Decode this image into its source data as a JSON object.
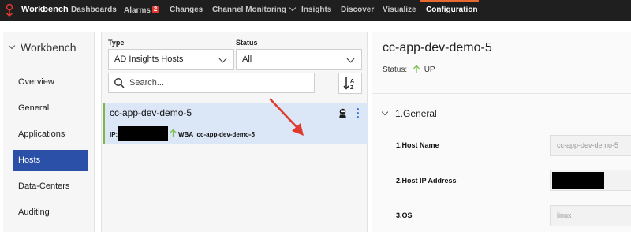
{
  "topbar": {
    "brand": "Workbench",
    "nav": [
      {
        "label": "Dashboards"
      },
      {
        "label": "Alarms",
        "badge": "2"
      },
      {
        "label": "Changes"
      },
      {
        "label": "Channel Monitoring"
      },
      {
        "label": "Insights"
      },
      {
        "label": "Discover"
      },
      {
        "label": "Visualize"
      },
      {
        "label": "Configuration"
      }
    ],
    "active": "Configuration",
    "accent_color": "#e8692f"
  },
  "sidebar": {
    "title": "Workbench",
    "items": [
      {
        "label": "Overview"
      },
      {
        "label": "General"
      },
      {
        "label": "Applications"
      },
      {
        "label": "Hosts"
      },
      {
        "label": "Data-Centers"
      },
      {
        "label": "Auditing"
      }
    ],
    "active": "Hosts",
    "active_color": "#2b50a8"
  },
  "filters": {
    "type_label": "Type",
    "type_value": "AD Insights Hosts",
    "status_label": "Status",
    "status_value": "All",
    "search_placeholder": "Search...",
    "sort_icon": "sort-alpha-icon"
  },
  "host_list": [
    {
      "name": "cc-app-dev-demo-5",
      "ip_label": "IP:",
      "wba_name": "WBA_cc-app-dev-demo-5",
      "status_icon": "up-arrow-icon",
      "agent_icon": "agent-icon"
    }
  ],
  "detail": {
    "title": "cc-app-dev-demo-5",
    "status_label": "Status:",
    "status_value": "UP",
    "status_color": "#7cbf4f",
    "section": "1.General",
    "fields": [
      {
        "label": "1.Host Name",
        "value": "cc-app-dev-demo-5"
      },
      {
        "label": "2.Host IP Address",
        "value": ""
      },
      {
        "label": "3.OS",
        "value": "linux"
      }
    ]
  },
  "annotation_color": "#e03a2f"
}
